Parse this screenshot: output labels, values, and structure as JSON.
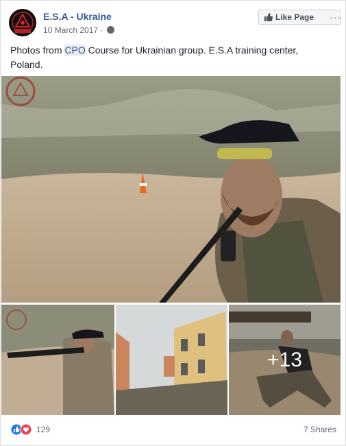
{
  "post": {
    "page_name": "E.S.A - Ukraine",
    "avatar_text": "UKRAINE",
    "date": "10 March 2017",
    "like_button": "Like Page",
    "more_dots": "···",
    "text_before": "Photos from ",
    "text_link": "CPO",
    "text_after": " Course for Ukrainian group. E.S.A training center, Poland.",
    "more_photos": "+13"
  },
  "footer": {
    "reactions_count": "129",
    "shares": "7 Shares"
  },
  "colors": {
    "link": "#365899",
    "like_blue": "#1877f2",
    "love_red": "#f33e58"
  },
  "icons": [
    "globe-icon",
    "thumbs-up-icon",
    "like-reaction-icon",
    "love-reaction-icon"
  ]
}
